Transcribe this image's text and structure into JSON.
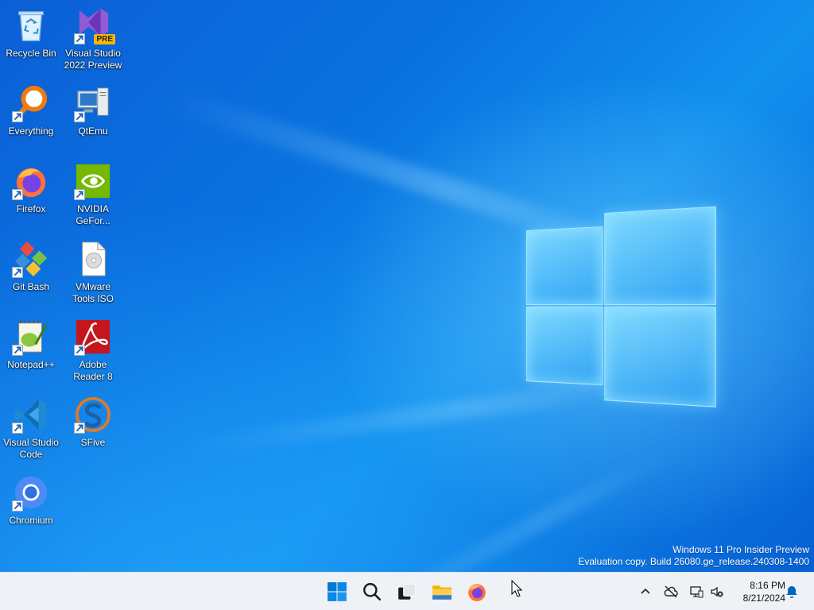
{
  "desktop": {
    "icons": [
      {
        "label": "Recycle Bin",
        "icon": "recycle-bin-icon"
      },
      {
        "label": "Visual Studio 2022 Preview",
        "icon": "visual-studio-preview-icon",
        "badge": "PRE"
      },
      {
        "label": "Everything",
        "icon": "everything-search-icon"
      },
      {
        "label": "QtEmu",
        "icon": "qtemu-icon"
      },
      {
        "label": "Firefox",
        "icon": "firefox-icon"
      },
      {
        "label": "NVIDIA GeFor...",
        "icon": "nvidia-icon"
      },
      {
        "label": "Git Bash",
        "icon": "git-bash-icon"
      },
      {
        "label": "VMware Tools ISO",
        "icon": "iso-disc-icon"
      },
      {
        "label": "Notepad++",
        "icon": "notepad-plus-plus-icon"
      },
      {
        "label": "Adobe Reader 8",
        "icon": "adobe-reader-icon"
      },
      {
        "label": "Visual Studio Code",
        "icon": "vscode-icon"
      },
      {
        "label": "SFive",
        "icon": "sfive-icon"
      },
      {
        "label": "Chromium",
        "icon": "chromium-icon"
      }
    ],
    "watermark": {
      "line1": "Windows 11 Pro Insider Preview",
      "line2": "Evaluation copy. Build 26080.ge_release.240308-1400"
    }
  },
  "taskbar": {
    "buttons": [
      {
        "name": "start",
        "icon": "windows-start-icon"
      },
      {
        "name": "search",
        "icon": "search-icon"
      },
      {
        "name": "task-view",
        "icon": "task-view-icon"
      },
      {
        "name": "file-explorer",
        "icon": "folder-icon"
      },
      {
        "name": "firefox",
        "icon": "firefox-icon"
      }
    ],
    "tray": {
      "icons": [
        "chevron-up-icon",
        "onedrive-offline-icon",
        "network-icon",
        "volume-muted-icon",
        "notification-bell-icon"
      ]
    },
    "clock": {
      "time": "8:16 PM",
      "date": "8/21/2024"
    }
  },
  "colors": {
    "desktop_blue": "#0a73e0",
    "taskbar": "#eef1f5",
    "accent": "#0067c0"
  }
}
